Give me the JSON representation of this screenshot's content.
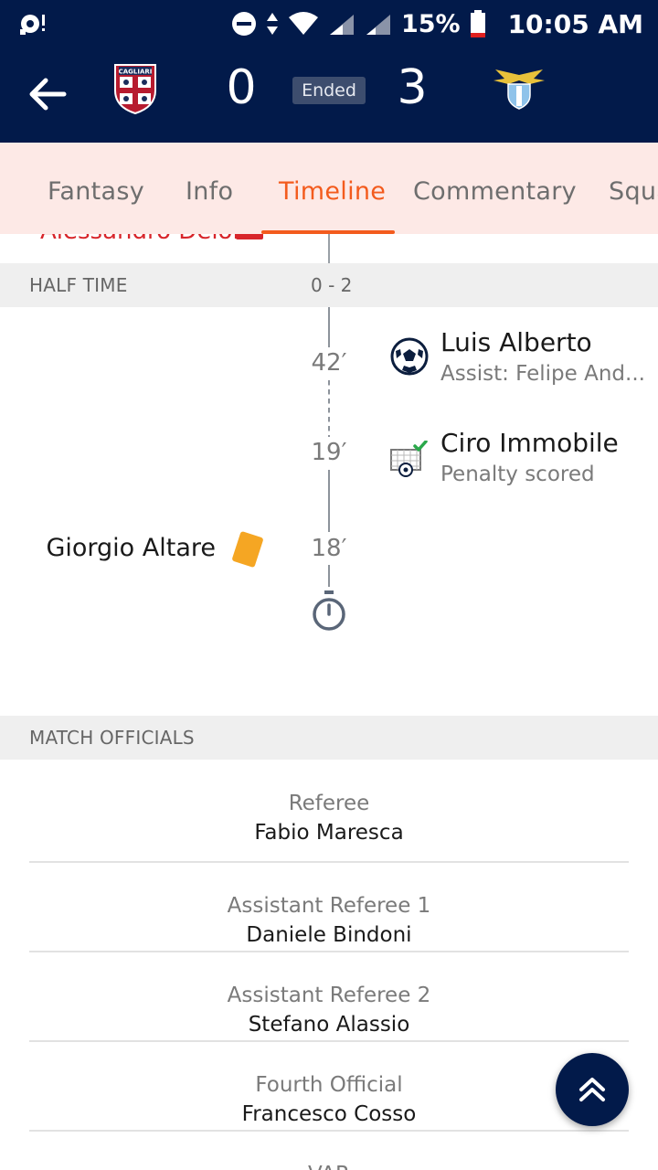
{
  "status_bar": {
    "battery": "15%",
    "time": "10:05 AM"
  },
  "match": {
    "home_score": "0",
    "away_score": "3",
    "status": "Ended",
    "home_crest_text": "CAGLIARI"
  },
  "tabs": [
    {
      "label": "Fantasy"
    },
    {
      "label": "Info"
    },
    {
      "label": "Timeline"
    },
    {
      "label": "Commentary"
    },
    {
      "label": "Squa"
    }
  ],
  "partial_event": {
    "player": "Alessandro Deiola"
  },
  "half_time": {
    "label": "HALF TIME",
    "score": "0 - 2"
  },
  "events": [
    {
      "minute": "42′",
      "player": "Luis Alberto",
      "detail": "Assist: Felipe And...",
      "icon": "football-icon"
    },
    {
      "minute": "19′",
      "player": "Ciro Immobile",
      "detail": "Penalty scored",
      "icon": "penalty-goal-icon"
    },
    {
      "minute": "18′",
      "player": "Giorgio Altare",
      "icon": "yellow-card-icon"
    }
  ],
  "officials_section": {
    "label": "MATCH OFFICIALS",
    "items": [
      {
        "role": "Referee",
        "name": "Fabio Maresca"
      },
      {
        "role": "Assistant Referee 1",
        "name": "Daniele Bindoni"
      },
      {
        "role": "Assistant Referee 2",
        "name": "Stefano Alassio"
      },
      {
        "role": "Fourth Official",
        "name": "Francesco Cosso"
      },
      {
        "role": "VAR",
        "name": ""
      }
    ]
  },
  "colors": {
    "header_bg": "#021a4a",
    "accent": "#f35b1d",
    "tabs_bg": "#fde9e6",
    "yellow_card": "#f5a623",
    "red_card": "#d8262b"
  }
}
